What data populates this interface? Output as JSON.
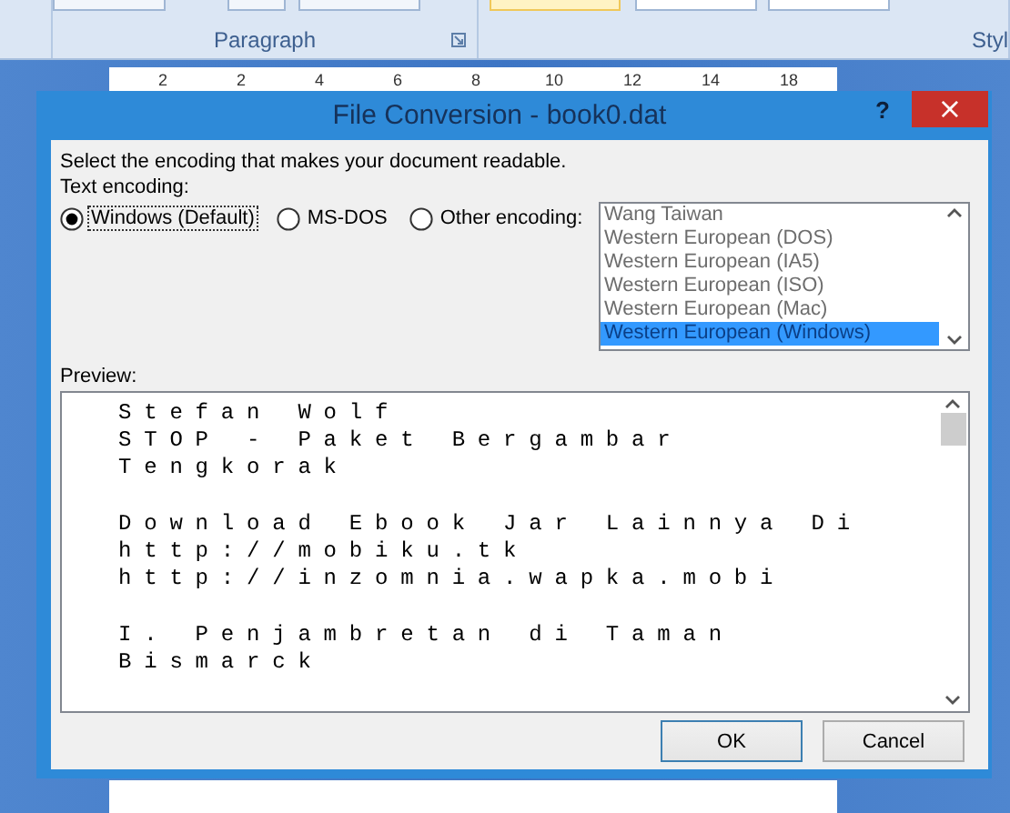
{
  "ribbon": {
    "groups": [
      {
        "label": "Paragraph"
      },
      {
        "label": "Styl"
      }
    ]
  },
  "ruler": {
    "labels": [
      "2",
      "2",
      "4",
      "6",
      "8",
      "10",
      "12",
      "14",
      "18"
    ]
  },
  "dialog": {
    "title": "File Conversion - book0.dat",
    "help": "?",
    "close": "×",
    "instruction": "Select the encoding that makes your document readable.",
    "encoding_label": "Text encoding:",
    "options": [
      {
        "label": "Windows (Default)",
        "selected": true,
        "focused": true
      },
      {
        "label": "MS-DOS",
        "selected": false,
        "focused": false
      },
      {
        "label": "Other encoding:",
        "selected": false,
        "focused": false
      }
    ],
    "encoding_list": {
      "disabled": true,
      "items": [
        {
          "label": "Wang Taiwan",
          "selected": false
        },
        {
          "label": "Western European (DOS)",
          "selected": false
        },
        {
          "label": "Western European (IA5)",
          "selected": false
        },
        {
          "label": "Western European (ISO)",
          "selected": false
        },
        {
          "label": "Western European (Mac)",
          "selected": false
        },
        {
          "label": "Western European (Windows)",
          "selected": true
        }
      ]
    },
    "preview_label": "Preview:",
    "preview_paragraphs": [
      [
        "Stefan Wolf",
        "STOP - Paket Bergambar",
        "Tengkorak"
      ],
      [
        "Download Ebook Jar Lainnya Di",
        "http://mobiku.tk",
        "http://inzomnia.wapka.mobi"
      ],
      [
        "I. Penjambretan di Taman",
        "Bismarck"
      ]
    ],
    "buttons": [
      {
        "label": "OK",
        "default": true
      },
      {
        "label": "Cancel",
        "default": false
      }
    ]
  }
}
